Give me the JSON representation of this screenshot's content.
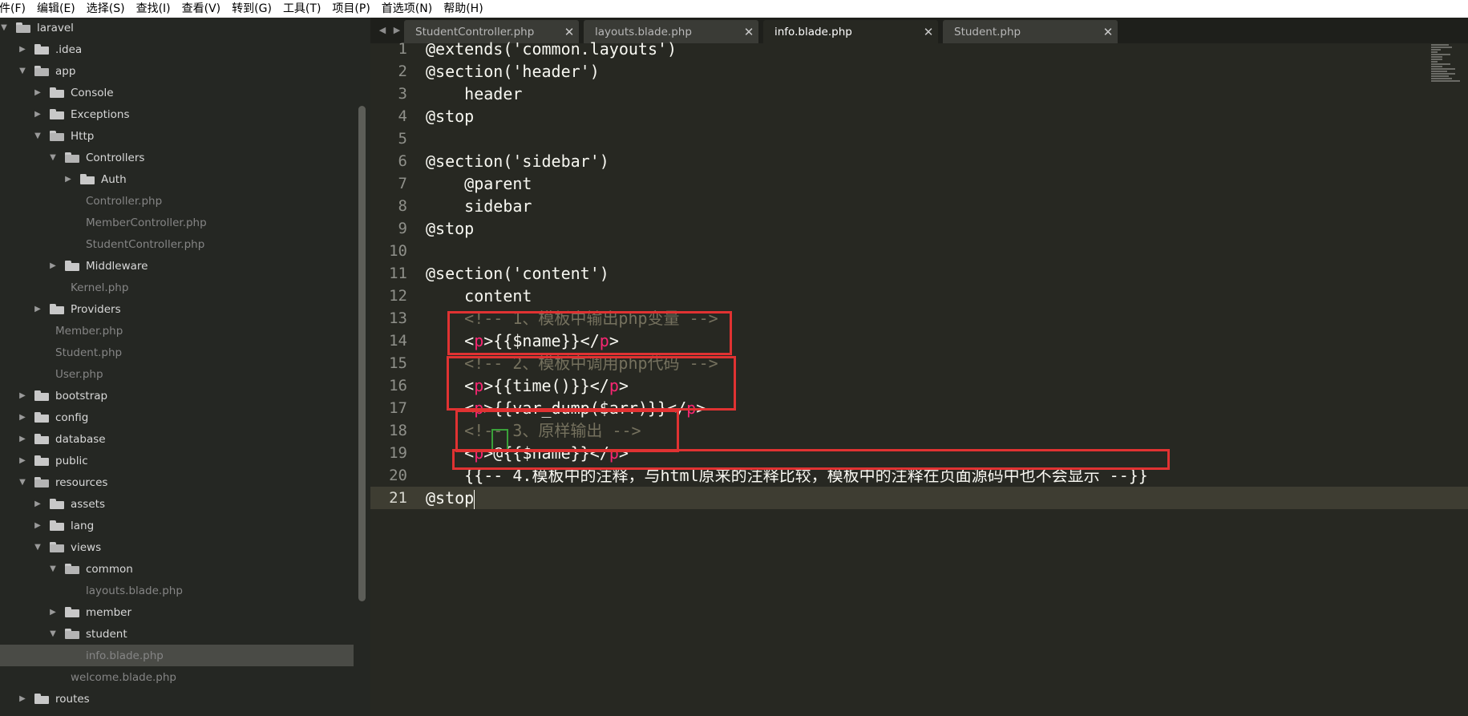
{
  "menubar": {
    "items": [
      "件(F)",
      "编辑(E)",
      "选择(S)",
      "查找(I)",
      "查看(V)",
      "转到(G)",
      "工具(T)",
      "项目(P)",
      "首选项(N)",
      "帮助(H)"
    ]
  },
  "sidebar": {
    "items": [
      {
        "label": "laravel",
        "kind": "folder",
        "state": "open"
      },
      {
        "label": ".idea",
        "kind": "folder",
        "state": "closed"
      },
      {
        "label": "app",
        "kind": "folder",
        "state": "open"
      },
      {
        "label": "Console",
        "kind": "folder",
        "state": "closed"
      },
      {
        "label": "Exceptions",
        "kind": "folder",
        "state": "closed"
      },
      {
        "label": "Http",
        "kind": "folder",
        "state": "open"
      },
      {
        "label": "Controllers",
        "kind": "folder",
        "state": "open"
      },
      {
        "label": "Auth",
        "kind": "folder",
        "state": "closed"
      },
      {
        "label": "Controller.php",
        "kind": "file"
      },
      {
        "label": "MemberController.php",
        "kind": "file"
      },
      {
        "label": "StudentController.php",
        "kind": "file"
      },
      {
        "label": "Middleware",
        "kind": "folder",
        "state": "closed"
      },
      {
        "label": "Kernel.php",
        "kind": "file"
      },
      {
        "label": "Providers",
        "kind": "folder",
        "state": "closed"
      },
      {
        "label": "Member.php",
        "kind": "file"
      },
      {
        "label": "Student.php",
        "kind": "file"
      },
      {
        "label": "User.php",
        "kind": "file"
      },
      {
        "label": "bootstrap",
        "kind": "folder",
        "state": "closed"
      },
      {
        "label": "config",
        "kind": "folder",
        "state": "closed"
      },
      {
        "label": "database",
        "kind": "folder",
        "state": "closed"
      },
      {
        "label": "public",
        "kind": "folder",
        "state": "closed"
      },
      {
        "label": "resources",
        "kind": "folder",
        "state": "open"
      },
      {
        "label": "assets",
        "kind": "folder",
        "state": "closed"
      },
      {
        "label": "lang",
        "kind": "folder",
        "state": "closed"
      },
      {
        "label": "views",
        "kind": "folder",
        "state": "open"
      },
      {
        "label": "common",
        "kind": "folder",
        "state": "open"
      },
      {
        "label": "layouts.blade.php",
        "kind": "file"
      },
      {
        "label": "member",
        "kind": "folder",
        "state": "closed"
      },
      {
        "label": "student",
        "kind": "folder",
        "state": "open"
      },
      {
        "label": "info.blade.php",
        "kind": "file",
        "selected": true
      },
      {
        "label": "welcome.blade.php",
        "kind": "file"
      },
      {
        "label": "routes",
        "kind": "folder",
        "state": "closed"
      }
    ]
  },
  "tabs": [
    {
      "label": "StudentController.php",
      "close": "✕",
      "active": false
    },
    {
      "label": "layouts.blade.php",
      "close": "✕",
      "active": false
    },
    {
      "label": "info.blade.php",
      "close": "✕",
      "active": true
    },
    {
      "label": "Student.php",
      "close": "✕",
      "active": false
    }
  ],
  "tab_nav": {
    "left": "◀",
    "right": "▶"
  },
  "editor": {
    "current_line": 21,
    "lines": [
      {
        "n": "1",
        "parts": [
          {
            "t": "@extends('common.layouts')",
            "c": ""
          }
        ]
      },
      {
        "n": "2",
        "parts": [
          {
            "t": "@section('header')",
            "c": ""
          }
        ]
      },
      {
        "n": "3",
        "parts": [
          {
            "t": "    header",
            "c": ""
          }
        ]
      },
      {
        "n": "4",
        "parts": [
          {
            "t": "@stop",
            "c": ""
          }
        ]
      },
      {
        "n": "5",
        "parts": []
      },
      {
        "n": "6",
        "parts": [
          {
            "t": "@section('sidebar')",
            "c": ""
          }
        ]
      },
      {
        "n": "7",
        "parts": [
          {
            "t": "    @parent",
            "c": ""
          }
        ]
      },
      {
        "n": "8",
        "parts": [
          {
            "t": "    sidebar",
            "c": ""
          }
        ]
      },
      {
        "n": "9",
        "parts": [
          {
            "t": "@stop",
            "c": ""
          }
        ]
      },
      {
        "n": "10",
        "parts": []
      },
      {
        "n": "11",
        "parts": [
          {
            "t": "@section('content')",
            "c": ""
          }
        ]
      },
      {
        "n": "12",
        "parts": [
          {
            "t": "    content",
            "c": ""
          }
        ]
      },
      {
        "n": "13",
        "parts": [
          {
            "t": "    ",
            "c": ""
          },
          {
            "t": "<!-- 1、模板中输出php变量 -->",
            "c": "comment"
          }
        ]
      },
      {
        "n": "14",
        "parts": [
          {
            "t": "    <",
            "c": ""
          },
          {
            "t": "p",
            "c": "tag"
          },
          {
            "t": ">{{$name}}</",
            "c": ""
          },
          {
            "t": "p",
            "c": "tag"
          },
          {
            "t": ">",
            "c": ""
          }
        ]
      },
      {
        "n": "15",
        "parts": [
          {
            "t": "    ",
            "c": ""
          },
          {
            "t": "<!-- 2、模板中调用php代码 -->",
            "c": "comment"
          }
        ]
      },
      {
        "n": "16",
        "parts": [
          {
            "t": "    <",
            "c": ""
          },
          {
            "t": "p",
            "c": "tag"
          },
          {
            "t": ">{{time()}}</",
            "c": ""
          },
          {
            "t": "p",
            "c": "tag"
          },
          {
            "t": ">",
            "c": ""
          }
        ]
      },
      {
        "n": "17",
        "parts": [
          {
            "t": "    <",
            "c": ""
          },
          {
            "t": "p",
            "c": "tag"
          },
          {
            "t": ">{{var_dump($arr)}}</",
            "c": ""
          },
          {
            "t": "p",
            "c": "tag"
          },
          {
            "t": ">",
            "c": ""
          }
        ]
      },
      {
        "n": "18",
        "parts": [
          {
            "t": "    ",
            "c": ""
          },
          {
            "t": "<!-- 3、原样输出 -->",
            "c": "comment"
          }
        ]
      },
      {
        "n": "19",
        "parts": [
          {
            "t": "    <",
            "c": ""
          },
          {
            "t": "p",
            "c": "tag"
          },
          {
            "t": ">@{{$name}}</",
            "c": ""
          },
          {
            "t": "p",
            "c": "tag"
          },
          {
            "t": ">",
            "c": ""
          }
        ]
      },
      {
        "n": "20",
        "parts": [
          {
            "t": "    {{-- 4.模板中的注释，与html原来的注释比较，模板中的注释在页面源码中也不会显示 --}}",
            "c": ""
          }
        ]
      },
      {
        "n": "21",
        "parts": [
          {
            "t": "@stop",
            "c": ""
          }
        ]
      }
    ]
  },
  "colors": {
    "editor_bg": "#272822",
    "sidebar_bg": "#252723",
    "tag": "#f92672",
    "comment": "#75715e",
    "highlight_box": "#e03232",
    "green_box": "#3aa13a"
  }
}
